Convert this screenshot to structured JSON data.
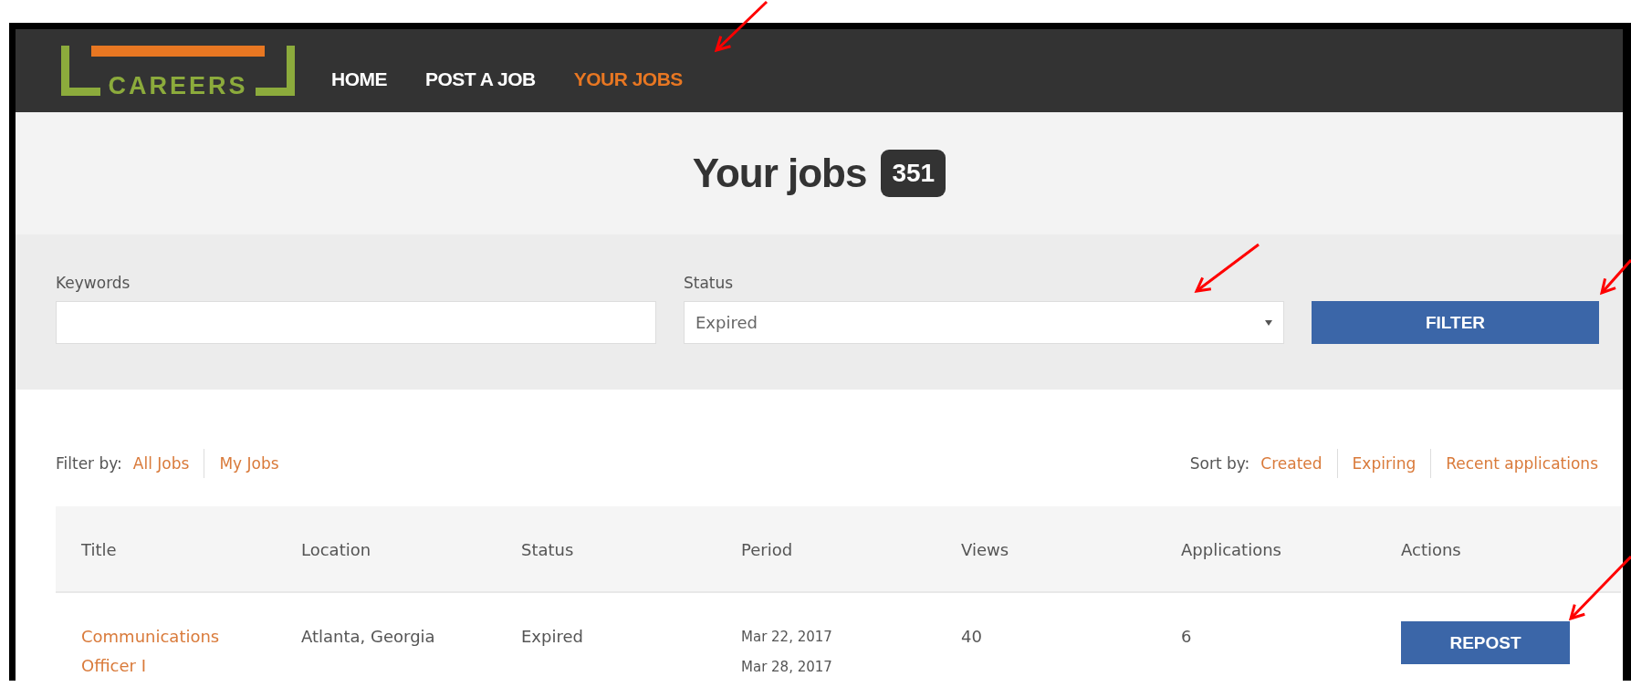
{
  "nav": {
    "logo": "CAREERS",
    "links": [
      {
        "label": "HOME",
        "selected": false
      },
      {
        "label": "POST A JOB",
        "selected": false
      },
      {
        "label": "YOUR JOBS",
        "selected": true
      }
    ]
  },
  "header": {
    "title": "Your jobs",
    "count": "351"
  },
  "filters": {
    "keywords": {
      "label": "Keywords"
    },
    "status": {
      "label": "Status",
      "value": "Expired"
    },
    "button": "FILTER"
  },
  "filter_by": {
    "label": "Filter by:",
    "options": [
      "All Jobs",
      "My Jobs"
    ]
  },
  "sort_by": {
    "label": "Sort by:",
    "options": [
      "Created",
      "Expiring",
      "Recent applications"
    ]
  },
  "table": {
    "columns": [
      "Title",
      "Location",
      "Status",
      "Period",
      "Views",
      "Applications",
      "Actions"
    ],
    "rows": [
      {
        "title": "Communications Officer I",
        "location": "Atlanta, Georgia",
        "status": "Expired",
        "period": [
          "Mar 22, 2017",
          "Mar 28, 2017"
        ],
        "views": "40",
        "applications": "6",
        "action": "REPOST"
      }
    ]
  }
}
